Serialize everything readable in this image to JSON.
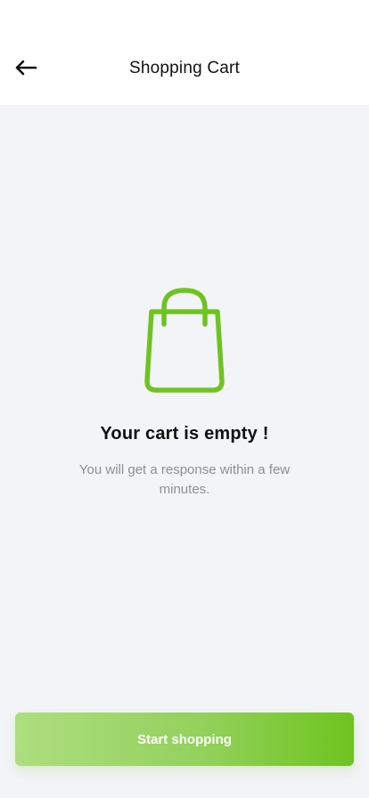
{
  "header": {
    "back_icon": "arrow-left-icon",
    "title": "Shopping Cart"
  },
  "empty_state": {
    "icon": "shopping-bag-icon",
    "icon_color": "#6ec41f",
    "title": "Your cart is empty !",
    "subtitle": "You will get a response within a few minutes."
  },
  "cta": {
    "label": "Start shopping",
    "gradient_start": "#aede80",
    "gradient_end": "#6ec41f"
  }
}
